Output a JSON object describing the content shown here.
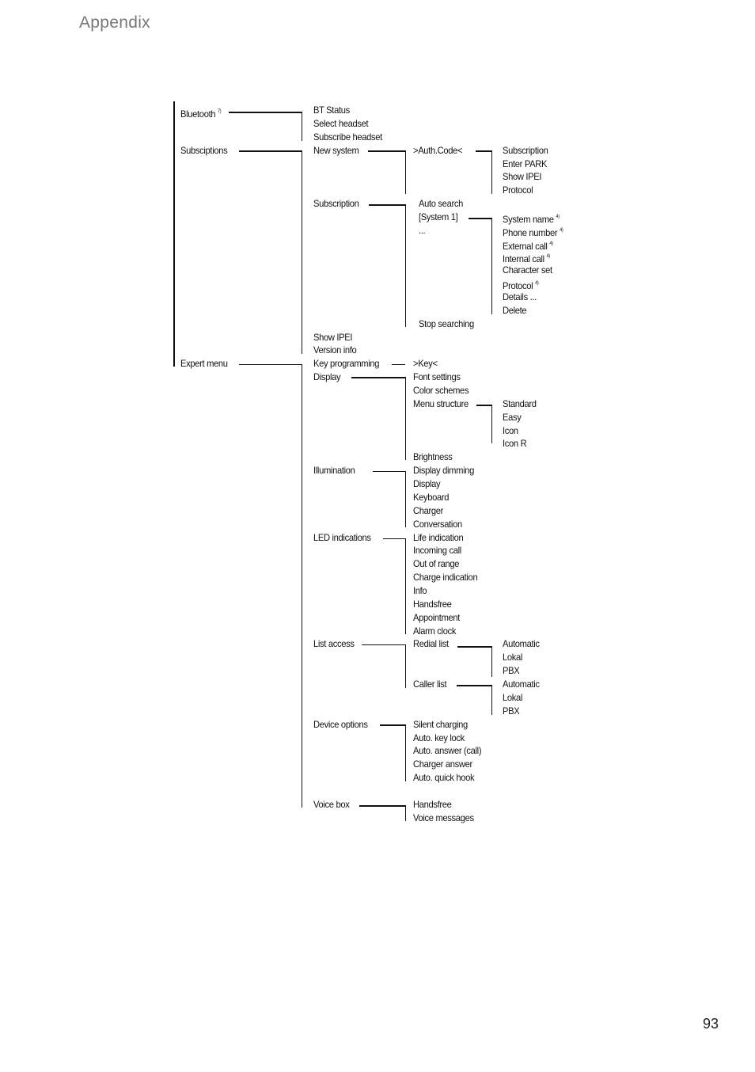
{
  "header": {
    "title": "Appendix"
  },
  "footer": {
    "page_number": "93"
  },
  "menu_tree": {
    "level1": [
      {
        "label": "Bluetooth",
        "note": "7)"
      },
      {
        "label": "Subsciptions"
      },
      {
        "label": "Expert menu"
      }
    ],
    "level2": [
      {
        "label": "BT Status"
      },
      {
        "label": "Select headset"
      },
      {
        "label": "Subscribe headset"
      },
      {
        "label": "New system"
      },
      {
        "label": "Subscription"
      },
      {
        "label": "Show IPEI"
      },
      {
        "label": "Version info"
      },
      {
        "label": "Key programming"
      },
      {
        "label": "Display"
      },
      {
        "label": "Illumination"
      },
      {
        "label": "LED indications"
      },
      {
        "label": "List access"
      },
      {
        "label": "Device options"
      },
      {
        "label": "Voice box"
      }
    ],
    "level3": [
      {
        "label": ">Auth.Code<"
      },
      {
        "label": "Auto search"
      },
      {
        "label": "[System 1]"
      },
      {
        "label": "..."
      },
      {
        "label": "Stop searching"
      },
      {
        "label": ">Key<"
      },
      {
        "label": "Font settings"
      },
      {
        "label": "Color schemes"
      },
      {
        "label": "Menu structure"
      },
      {
        "label": "Brightness"
      },
      {
        "label": "Display dimming"
      },
      {
        "label": "Display"
      },
      {
        "label": "Keyboard"
      },
      {
        "label": "Charger"
      },
      {
        "label": "Conversation"
      },
      {
        "label": "Life indication"
      },
      {
        "label": "Incoming call"
      },
      {
        "label": "Out of range"
      },
      {
        "label": "Charge indication"
      },
      {
        "label": "Info"
      },
      {
        "label": "Handsfree"
      },
      {
        "label": "Appointment"
      },
      {
        "label": "Alarm clock"
      },
      {
        "label": "Redial list"
      },
      {
        "label": "Caller list"
      },
      {
        "label": "Silent charging"
      },
      {
        "label": "Auto. key lock"
      },
      {
        "label": "Auto. answer (call)"
      },
      {
        "label": "Charger answer"
      },
      {
        "label": "Auto. quick hook"
      },
      {
        "label": "Handsfree"
      },
      {
        "label": "Voice messages"
      }
    ],
    "level4": [
      {
        "label": "Subscription"
      },
      {
        "label": "Enter PARK"
      },
      {
        "label": "Show IPEI"
      },
      {
        "label": "Protocol"
      },
      {
        "label": "System name",
        "note": "4)"
      },
      {
        "label": "Phone number",
        "note": "4)"
      },
      {
        "label": "External call",
        "note": "4)"
      },
      {
        "label": "Internal call",
        "note": "4)"
      },
      {
        "label": "Character set"
      },
      {
        "label": "Protocol",
        "note": "4)"
      },
      {
        "label": "Details ..."
      },
      {
        "label": "Delete"
      },
      {
        "label": "Standard"
      },
      {
        "label": "Easy"
      },
      {
        "label": "Icon"
      },
      {
        "label": "Icon R"
      },
      {
        "label": "Automatic"
      },
      {
        "label": "Lokal"
      },
      {
        "label": "PBX"
      },
      {
        "label": "Automatic"
      },
      {
        "label": "Lokal"
      },
      {
        "label": "PBX"
      }
    ]
  }
}
